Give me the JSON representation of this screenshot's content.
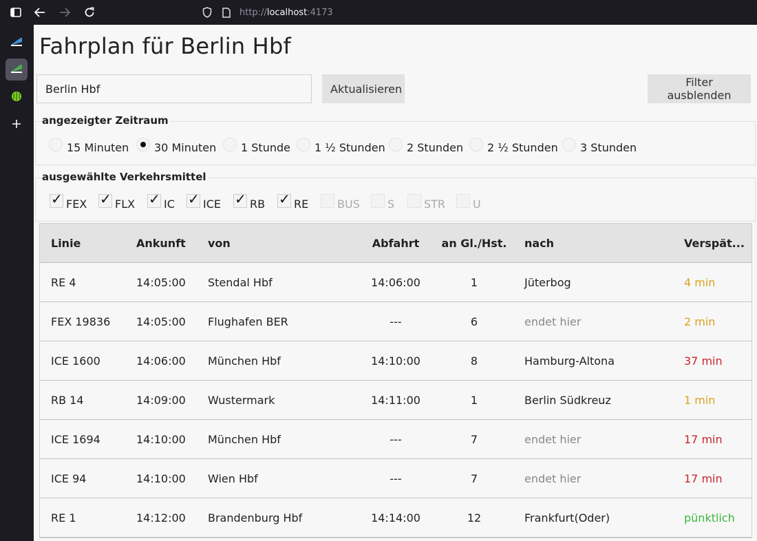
{
  "browser": {
    "url_prefix": "http://",
    "url_host": "localhost",
    "url_port": ":4173"
  },
  "page": {
    "title": "Fahrplan für Berlin Hbf",
    "station_value": "Berlin Hbf",
    "refresh_label": "Aktualisieren",
    "filter_label": "Filter ausblenden"
  },
  "timespan": {
    "legend": "angezeigter Zeitraum",
    "options": [
      "15 Minuten",
      "30 Minuten",
      "1 Stunde",
      "1 ½ Stunden",
      "2 Stunden",
      "2 ½ Stunden",
      "3 Stunden"
    ],
    "selected": "30 Minuten"
  },
  "modes": {
    "legend": "ausgewählte Verkehrsmittel",
    "options": [
      {
        "label": "FEX",
        "checked": true
      },
      {
        "label": "FLX",
        "checked": true
      },
      {
        "label": "IC",
        "checked": true
      },
      {
        "label": "ICE",
        "checked": true
      },
      {
        "label": "RB",
        "checked": true
      },
      {
        "label": "RE",
        "checked": true
      },
      {
        "label": "BUS",
        "checked": false
      },
      {
        "label": "S",
        "checked": false
      },
      {
        "label": "STR",
        "checked": false
      },
      {
        "label": "U",
        "checked": false
      }
    ]
  },
  "table": {
    "headers": [
      "Linie",
      "Ankunft",
      "von",
      "Abfahrt",
      "an Gl./Hst.",
      "nach",
      "Verspät..."
    ],
    "rows": [
      {
        "linie": "RE 4",
        "ankunft": "14:05:00",
        "von": "Stendal Hbf",
        "abfahrt": "14:06:00",
        "gleis": "1",
        "nach": "Jüterbog",
        "verspaetung": "4 min",
        "status": "minor"
      },
      {
        "linie": "FEX 19836",
        "ankunft": "14:05:00",
        "von": "Flughafen BER",
        "abfahrt": "---",
        "gleis": "6",
        "nach": "endet hier",
        "verspaetung": "2 min",
        "status": "minor"
      },
      {
        "linie": "ICE 1600",
        "ankunft": "14:06:00",
        "von": "München Hbf",
        "abfahrt": "14:10:00",
        "gleis": "8",
        "nach": "Hamburg-Altona",
        "verspaetung": "37 min",
        "status": "major"
      },
      {
        "linie": "RB 14",
        "ankunft": "14:09:00",
        "von": "Wustermark",
        "abfahrt": "14:11:00",
        "gleis": "1",
        "nach": "Berlin Südkreuz",
        "verspaetung": "1 min",
        "status": "minor"
      },
      {
        "linie": "ICE 1694",
        "ankunft": "14:10:00",
        "von": "München Hbf",
        "abfahrt": "---",
        "gleis": "7",
        "nach": "endet hier",
        "verspaetung": "17 min",
        "status": "major"
      },
      {
        "linie": "ICE 94",
        "ankunft": "14:10:00",
        "von": "Wien Hbf",
        "abfahrt": "---",
        "gleis": "7",
        "nach": "endet hier",
        "verspaetung": "17 min",
        "status": "major"
      },
      {
        "linie": "RE 1",
        "ankunft": "14:12:00",
        "von": "Brandenburg Hbf",
        "abfahrt": "14:14:00",
        "gleis": "12",
        "nach": "Frankfurt(Oder)",
        "verspaetung": "pünktlich",
        "status": "ontime"
      }
    ]
  },
  "colors": {
    "minor": "#d9a21f",
    "major": "#c9252b",
    "ontime": "#3cb93c",
    "ends_here": "#888888"
  }
}
